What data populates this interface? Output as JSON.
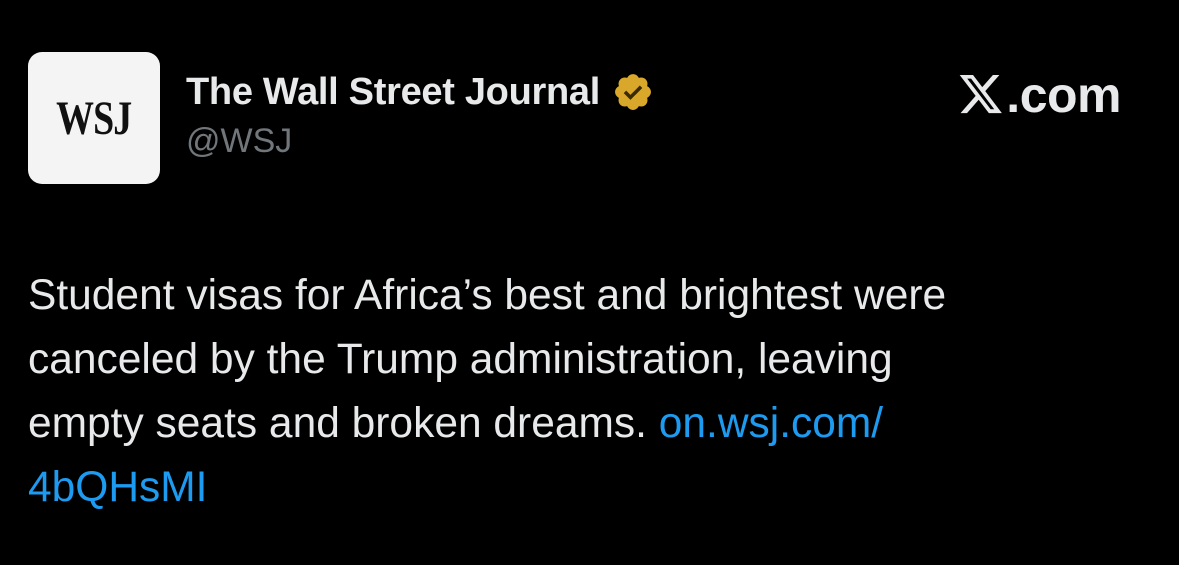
{
  "account": {
    "avatar_text": "WSJ",
    "display_name": "The Wall Street Journal",
    "handle": "@WSJ",
    "verified_icon": "gold-verified-badge-icon",
    "verified_color": "#d9a82b"
  },
  "platform": {
    "logo_icon": "x-logo-icon",
    "suffix": ".com"
  },
  "tweet": {
    "line1": "Student visas for Africa’s best and brightest were",
    "line2": "canceled by the Trump administration, leaving",
    "line3_text": "empty seats and broken dreams.",
    "link_part1": "on.wsj.com/",
    "link_part2": "4bQHsMI"
  },
  "colors": {
    "background": "#000000",
    "text": "#e7e9ea",
    "muted": "#71767b",
    "link": "#1d9bf0"
  }
}
